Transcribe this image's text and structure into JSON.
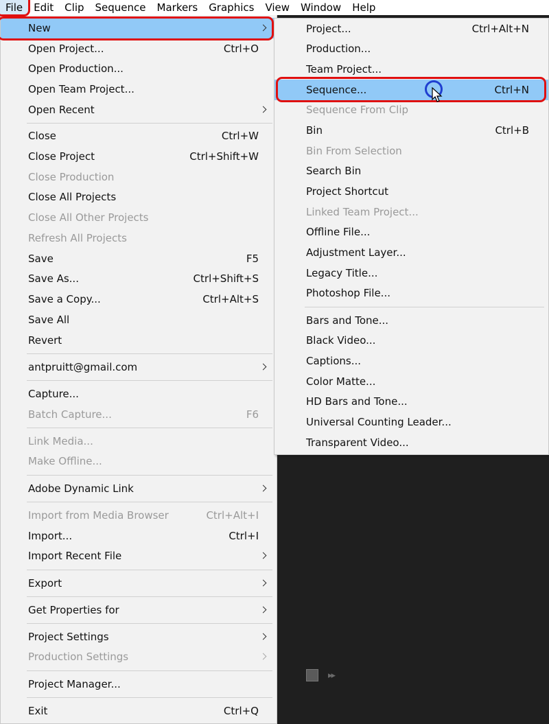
{
  "menubar": {
    "items": [
      "File",
      "Edit",
      "Clip",
      "Sequence",
      "Markers",
      "Graphics",
      "View",
      "Window",
      "Help"
    ]
  },
  "file_menu": {
    "items": [
      {
        "label": "New",
        "submenu": true
      },
      {
        "label": "Open Project...",
        "shortcut": "Ctrl+O"
      },
      {
        "label": "Open Production..."
      },
      {
        "label": "Open Team Project..."
      },
      {
        "label": "Open Recent",
        "submenu": true
      },
      {
        "label": "Close",
        "shortcut": "Ctrl+W"
      },
      {
        "label": "Close Project",
        "shortcut": "Ctrl+Shift+W"
      },
      {
        "label": "Close Production",
        "disabled": true
      },
      {
        "label": "Close All Projects"
      },
      {
        "label": "Close All Other Projects",
        "disabled": true
      },
      {
        "label": "Refresh All Projects",
        "disabled": true
      },
      {
        "label": "Save",
        "shortcut": "F5"
      },
      {
        "label": "Save As...",
        "shortcut": "Ctrl+Shift+S"
      },
      {
        "label": "Save a Copy...",
        "shortcut": "Ctrl+Alt+S"
      },
      {
        "label": "Save All"
      },
      {
        "label": "Revert"
      },
      {
        "label": "antpruitt@gmail.com",
        "submenu": true
      },
      {
        "label": "Capture..."
      },
      {
        "label": "Batch Capture...",
        "shortcut": "F6",
        "disabled": true
      },
      {
        "label": "Link Media...",
        "disabled": true
      },
      {
        "label": "Make Offline...",
        "disabled": true
      },
      {
        "label": "Adobe Dynamic Link",
        "submenu": true
      },
      {
        "label": "Import from Media Browser",
        "shortcut": "Ctrl+Alt+I",
        "disabled": true
      },
      {
        "label": "Import...",
        "shortcut": "Ctrl+I"
      },
      {
        "label": "Import Recent File",
        "submenu": true
      },
      {
        "label": "Export",
        "submenu": true
      },
      {
        "label": "Get Properties for",
        "submenu": true
      },
      {
        "label": "Project Settings",
        "submenu": true
      },
      {
        "label": "Production Settings",
        "submenu": true,
        "disabled": true
      },
      {
        "label": "Project Manager..."
      },
      {
        "label": "Exit",
        "shortcut": "Ctrl+Q"
      }
    ]
  },
  "new_submenu": {
    "items": [
      {
        "label": "Project...",
        "shortcut": "Ctrl+Alt+N"
      },
      {
        "label": "Production..."
      },
      {
        "label": "Team Project..."
      },
      {
        "label": "Sequence...",
        "shortcut": "Ctrl+N"
      },
      {
        "label": "Sequence From Clip",
        "disabled": true
      },
      {
        "label": "Bin",
        "shortcut": "Ctrl+B"
      },
      {
        "label": "Bin From Selection",
        "disabled": true
      },
      {
        "label": "Search Bin"
      },
      {
        "label": "Project Shortcut"
      },
      {
        "label": "Linked Team Project...",
        "disabled": true
      },
      {
        "label": "Offline File..."
      },
      {
        "label": "Adjustment Layer..."
      },
      {
        "label": "Legacy Title..."
      },
      {
        "label": "Photoshop File..."
      },
      {
        "label": "Bars and Tone..."
      },
      {
        "label": "Black Video..."
      },
      {
        "label": "Captions..."
      },
      {
        "label": "Color Matte..."
      },
      {
        "label": "HD Bars and Tone..."
      },
      {
        "label": "Universal Counting Leader..."
      },
      {
        "label": "Transparent Video..."
      }
    ]
  },
  "colors": {
    "highlight": "#91c9f7",
    "annotation": "#e01010",
    "cursor_ring": "#1f3fd0"
  }
}
